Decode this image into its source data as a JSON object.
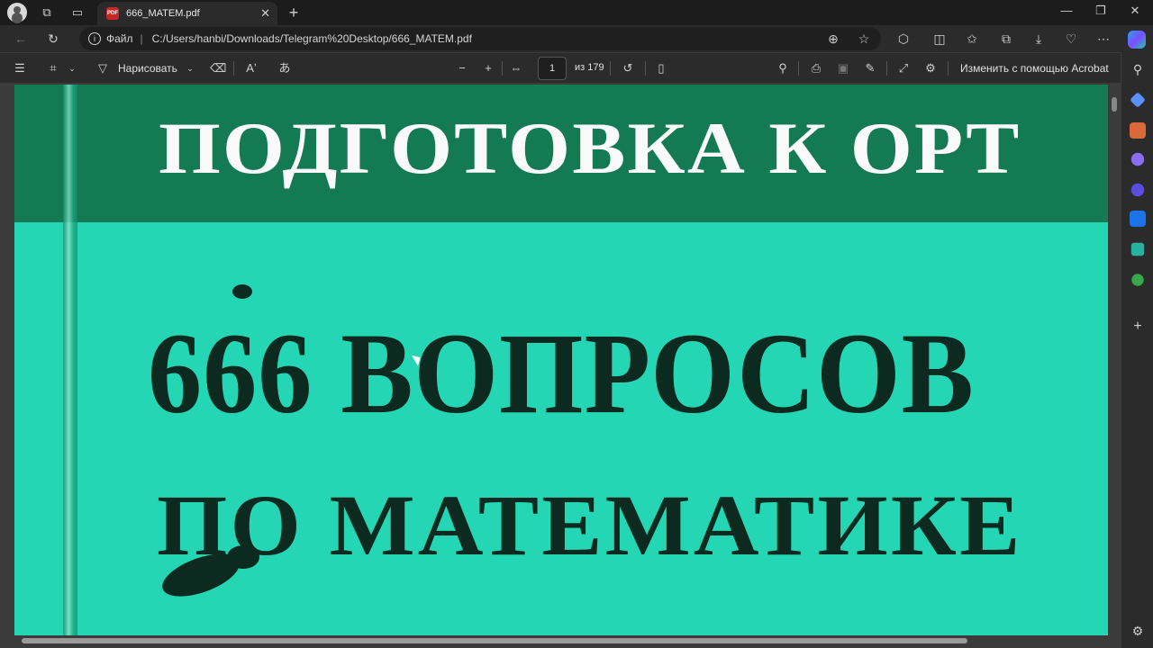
{
  "browser": {
    "tab_title": "666_MATEM.pdf",
    "tab_badge": "PDF",
    "url_label": "Файл",
    "url": "C:/Users/hanbi/Downloads/Telegram%20Desktop/666_MATEM.pdf"
  },
  "pdf_toolbar": {
    "draw_label": "Нарисовать",
    "page_current": "1",
    "page_total": "из 179",
    "edit_label": "Изменить с помощью Acrobat"
  },
  "document": {
    "line1": "ПОДГОТОВКА К ОРТ",
    "line2": "666 ВОПРОСОВ",
    "line3": "ПО МАТЕМАТИКЕ"
  },
  "colors": {
    "cover_top": "#137a54",
    "cover_main": "#24d6b3",
    "cover_dark_text": "#0c2a1f"
  },
  "icons": [
    "profile-icon",
    "workspaces-icon",
    "tab-actions-icon",
    "pdf-icon",
    "close-icon",
    "new-tab-icon",
    "minimize-icon",
    "maximize-icon",
    "window-close-icon",
    "back-icon",
    "refresh-icon",
    "info-icon",
    "zoom-icon",
    "favorite-icon",
    "extensions-icon",
    "split-screen-icon",
    "favorites-icon",
    "collections-icon",
    "download-icon",
    "browser-essentials-icon",
    "more-icon",
    "copilot-icon",
    "contents-icon",
    "highlight-icon",
    "draw-icon",
    "eraser-icon",
    "read-aloud-icon",
    "translate-icon",
    "zoom-out-icon",
    "zoom-in-icon",
    "fit-page-icon",
    "rotate-icon",
    "page-view-icon",
    "search-icon",
    "print-icon",
    "save-icon",
    "save-as-icon",
    "fullscreen-icon",
    "settings-icon"
  ]
}
